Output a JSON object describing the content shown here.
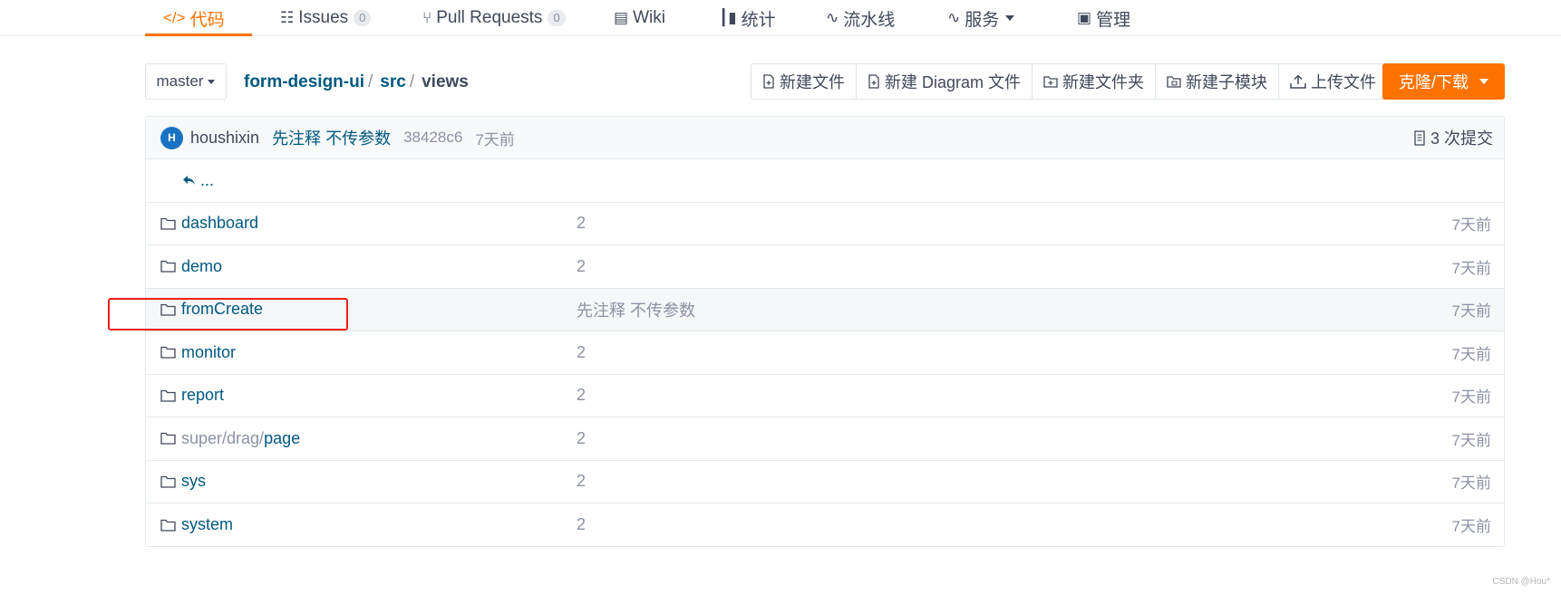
{
  "nav": {
    "tabs": [
      {
        "icon": "code-icon",
        "glyph": "</>",
        "label": "代码",
        "active": true
      },
      {
        "icon": "issues-icon",
        "glyph": "☷",
        "label": "Issues",
        "count": "0"
      },
      {
        "icon": "pull-request-icon",
        "glyph": "⑂",
        "label": "Pull Requests",
        "count": "0"
      },
      {
        "icon": "wiki-icon",
        "glyph": "▤",
        "label": "Wiki"
      },
      {
        "icon": "stats-icon",
        "glyph": "┃▮",
        "label": "统计"
      },
      {
        "icon": "pipeline-icon",
        "glyph": "∿",
        "label": "流水线"
      },
      {
        "icon": "services-icon",
        "glyph": "∿",
        "label": "服务"
      },
      {
        "icon": "manage-icon",
        "glyph": "▣",
        "label": "管理"
      }
    ]
  },
  "toolbar": {
    "branch": "master",
    "breadcrumb": [
      {
        "label": "form-design-ui",
        "sep": "/"
      },
      {
        "label": "src",
        "sep": "/"
      },
      {
        "label": "views"
      }
    ],
    "buttons": [
      {
        "icon": "new-file-icon",
        "label": "新建文件"
      },
      {
        "icon": "new-diagram-icon",
        "label": "新建 Diagram 文件"
      },
      {
        "icon": "new-folder-icon",
        "label": "新建文件夹"
      },
      {
        "icon": "new-submodule-icon",
        "label": "新建子模块"
      },
      {
        "icon": "upload-icon",
        "label": "上传文件"
      }
    ],
    "clone_label": "克隆/下载",
    "accent_color": "#fe7300"
  },
  "commit": {
    "avatar_letter": "H",
    "author": "houshixin",
    "message": "先注释 不传参数",
    "sha": "38428c6",
    "time": "7天前",
    "commit_count": "3 次提交"
  },
  "parent_link": "...",
  "files": [
    {
      "name": "dashboard",
      "message": "2",
      "time": "7天前"
    },
    {
      "name": "demo",
      "message": "2",
      "time": "7天前"
    },
    {
      "name": "fromCreate",
      "message": "先注释 不传参数",
      "time": "7天前",
      "highlighted": true
    },
    {
      "name": "monitor",
      "message": "2",
      "time": "7天前"
    },
    {
      "name": "report",
      "message": "2",
      "time": "7天前"
    },
    {
      "name_prefix": "super/drag/",
      "name": "page",
      "message": "2",
      "time": "7天前"
    },
    {
      "name": "sys",
      "message": "2",
      "time": "7天前"
    },
    {
      "name": "system",
      "message": "2",
      "time": "7天前"
    }
  ],
  "watermark": "CSDN @Hou*"
}
